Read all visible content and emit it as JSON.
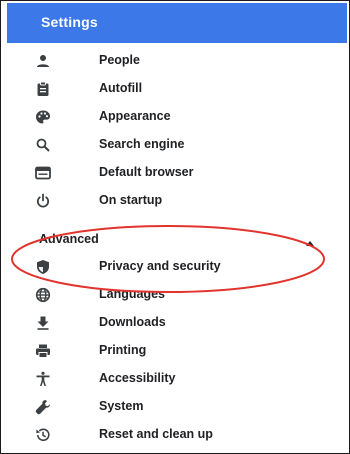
{
  "header": {
    "title": "Settings"
  },
  "menu": [
    {
      "label": "People",
      "icon": "person-icon"
    },
    {
      "label": "Autofill",
      "icon": "clipboard-icon"
    },
    {
      "label": "Appearance",
      "icon": "palette-icon"
    },
    {
      "label": "Search engine",
      "icon": "search-icon"
    },
    {
      "label": "Default browser",
      "icon": "browser-window-icon"
    },
    {
      "label": "On startup",
      "icon": "power-icon"
    }
  ],
  "advanced": {
    "label": "Advanced",
    "state": "expanded",
    "items": [
      {
        "label": "Privacy and security",
        "icon": "shield-icon"
      },
      {
        "label": "Languages",
        "icon": "globe-icon"
      },
      {
        "label": "Downloads",
        "icon": "download-icon"
      },
      {
        "label": "Printing",
        "icon": "printer-icon"
      },
      {
        "label": "Accessibility",
        "icon": "accessibility-icon"
      },
      {
        "label": "System",
        "icon": "wrench-icon"
      },
      {
        "label": "Reset and clean up",
        "icon": "restore-icon"
      }
    ]
  },
  "colors": {
    "header_bg": "#3c78e8",
    "icon": "#3c4043",
    "annotation": "#e0342c"
  }
}
